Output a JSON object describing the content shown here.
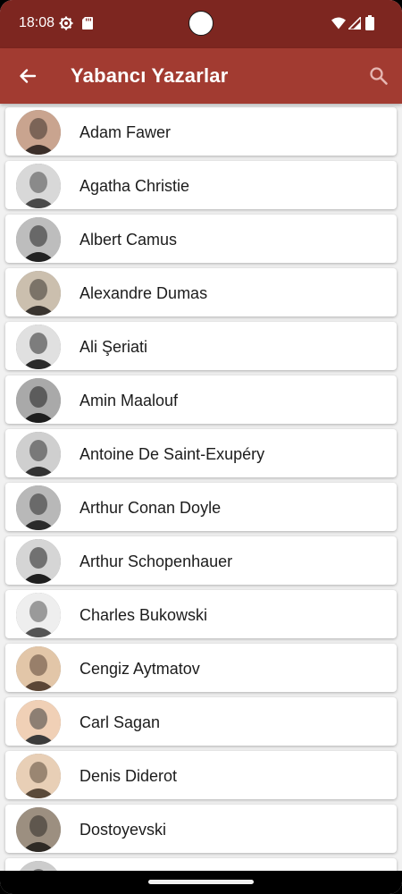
{
  "status_bar": {
    "time": "18:08",
    "icons": [
      "gear-icon",
      "sd-card-icon",
      "wifi-icon",
      "signal-icon",
      "battery-icon"
    ]
  },
  "app_bar": {
    "title": "Yabancı Yazarlar",
    "back_icon": "arrow-left-icon",
    "search_icon": "search-icon",
    "color": "#a23b31"
  },
  "colors": {
    "status_bar": "#7d2620",
    "app_bar": "#a23b31",
    "background": "#f1f1f1",
    "card": "#ffffff"
  },
  "authors": [
    {
      "name": "Adam Fawer",
      "avatar": "avatar-photo"
    },
    {
      "name": "Agatha Christie",
      "avatar": "avatar-photo"
    },
    {
      "name": "Albert Camus",
      "avatar": "avatar-photo"
    },
    {
      "name": "Alexandre Dumas",
      "avatar": "avatar-photo"
    },
    {
      "name": "Ali Şeriati",
      "avatar": "avatar-photo"
    },
    {
      "name": "Amin Maalouf",
      "avatar": "avatar-photo"
    },
    {
      "name": "Antoine De Saint-Exupéry",
      "avatar": "avatar-photo"
    },
    {
      "name": "Arthur Conan Doyle",
      "avatar": "avatar-photo"
    },
    {
      "name": "Arthur Schopenhauer",
      "avatar": "avatar-photo"
    },
    {
      "name": "Charles Bukowski",
      "avatar": "avatar-photo"
    },
    {
      "name": "Cengiz Aytmatov",
      "avatar": "avatar-photo"
    },
    {
      "name": "Carl Sagan",
      "avatar": "avatar-photo"
    },
    {
      "name": "Denis Diderot",
      "avatar": "avatar-photo"
    },
    {
      "name": "Dostoyevski",
      "avatar": "avatar-photo"
    },
    {
      "name": "",
      "avatar": "avatar-photo"
    }
  ]
}
